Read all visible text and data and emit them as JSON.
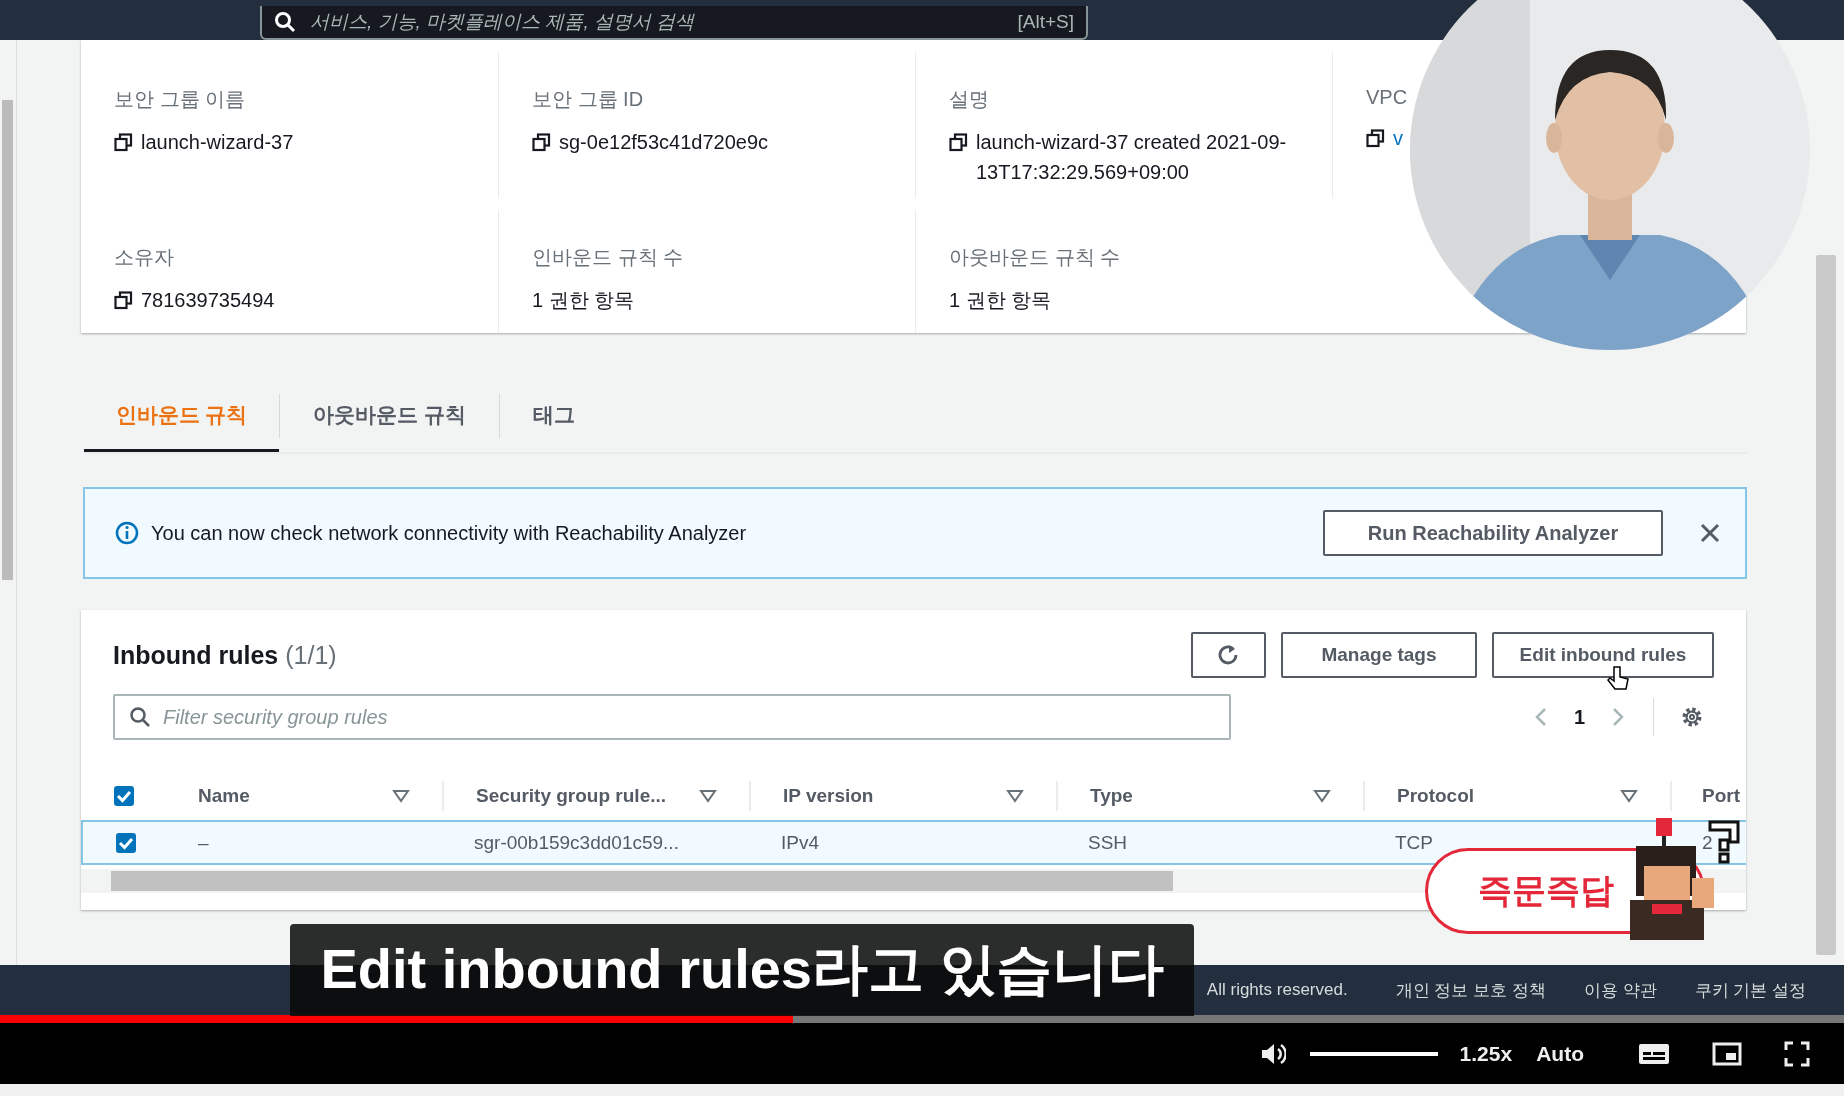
{
  "top_nav": {
    "search": {
      "placeholder": "서비스, 기능, 마켓플레이스 제품, 설명서 검색",
      "shortcut": "[Alt+S]"
    }
  },
  "details": [
    {
      "label": "보안 그룹 이름",
      "value": "launch-wizard-37",
      "copyable": true,
      "link": false
    },
    {
      "label": "보안 그룹 ID",
      "value": "sg-0e12f53c41d720e9c",
      "copyable": true,
      "link": false
    },
    {
      "label": "설명",
      "value": "launch-wizard-37 created 2021-09-13T17:32:29.569+09:00",
      "copyable": true,
      "link": false
    },
    {
      "label": "VPC",
      "value": "v",
      "copyable": true,
      "link": true
    },
    {
      "label": "소유자",
      "value": "781639735494",
      "copyable": true,
      "link": false
    },
    {
      "label": "인바운드 규칙 수",
      "value": "1 권한 항목",
      "copyable": false,
      "link": false
    },
    {
      "label": "아웃바운드 규칙 수",
      "value": "1 권한 항목",
      "copyable": false,
      "link": false
    }
  ],
  "tabs": [
    {
      "label": "인바운드 규칙",
      "selected": true
    },
    {
      "label": "아웃바운드 규칙",
      "selected": false
    },
    {
      "label": "태그",
      "selected": false
    }
  ],
  "banner": {
    "message": "You can now check network connectivity with Reachability Analyzer",
    "button": "Run Reachability Analyzer"
  },
  "inbound_rules": {
    "title": "Inbound rules",
    "count": "(1/1)",
    "buttons": [
      "Manage tags",
      "Edit inbound rules"
    ],
    "filter": {
      "placeholder": "Filter security group rules"
    },
    "page": "1",
    "all_checked": true,
    "columns": [
      "Name",
      "Security group rule...",
      "IP version",
      "Type",
      "Protocol",
      "Port"
    ],
    "rows": [
      {
        "selected": true,
        "cells": [
          "–",
          "sgr-00b159c3dd01c59...",
          "IPv4",
          "SSH",
          "TCP",
          "2"
        ]
      }
    ]
  },
  "footer": {
    "copyright": "All rights reserved.",
    "links": [
      "개인 정보 보호 정책",
      "이용 약관",
      "쿠키 기본 설정"
    ]
  },
  "subtitle": "Edit inbound rules라고 있습니다",
  "badge": "즉문즉답",
  "player": {
    "progress": {
      "level": 0.43
    },
    "volume": {
      "level": 1
    },
    "speed": "1.25x",
    "quality": "Auto"
  }
}
